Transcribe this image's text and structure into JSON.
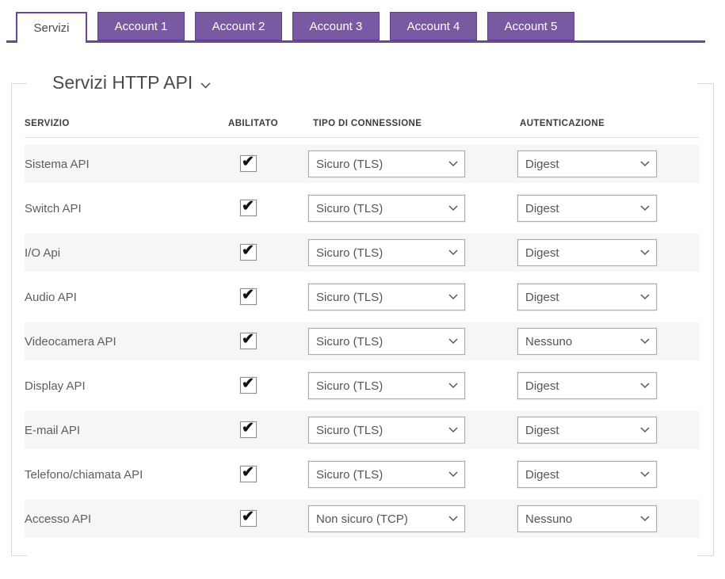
{
  "tabs": [
    {
      "label": "Servizi",
      "active": true
    },
    {
      "label": "Account 1",
      "active": false
    },
    {
      "label": "Account 2",
      "active": false
    },
    {
      "label": "Account 3",
      "active": false
    },
    {
      "label": "Account 4",
      "active": false
    },
    {
      "label": "Account 5",
      "active": false
    }
  ],
  "panel": {
    "title": "Servizi HTTP API",
    "column_headers": [
      "SERVIZIO",
      "ABILITATO",
      "TIPO DI CONNESSIONE",
      "AUTENTICAZIONE"
    ],
    "rows": [
      {
        "service": "Sistema API",
        "enabled": true,
        "connection": "Sicuro (TLS)",
        "auth": "Digest"
      },
      {
        "service": "Switch API",
        "enabled": true,
        "connection": "Sicuro (TLS)",
        "auth": "Digest"
      },
      {
        "service": "I/O Api",
        "enabled": true,
        "connection": "Sicuro (TLS)",
        "auth": "Digest"
      },
      {
        "service": "Audio API",
        "enabled": true,
        "connection": "Sicuro (TLS)",
        "auth": "Digest"
      },
      {
        "service": "Videocamera API",
        "enabled": true,
        "connection": "Sicuro (TLS)",
        "auth": "Nessuno"
      },
      {
        "service": "Display API",
        "enabled": true,
        "connection": "Sicuro (TLS)",
        "auth": "Digest"
      },
      {
        "service": "E-mail API",
        "enabled": true,
        "connection": "Sicuro (TLS)",
        "auth": "Digest"
      },
      {
        "service": "Telefono/chiamata API",
        "enabled": true,
        "connection": "Sicuro (TLS)",
        "auth": "Digest"
      },
      {
        "service": "Accesso API",
        "enabled": true,
        "connection": "Non sicuro (TCP)",
        "auth": "Nessuno"
      }
    ]
  },
  "colors": {
    "accent_purple": "#6b4596",
    "tab_purple": "#7a59a3",
    "tab_border": "#5e3d8f",
    "panel_border": "#d9d9d9",
    "row_stripe": "#f6f5f8",
    "checkmark": "#141414"
  }
}
